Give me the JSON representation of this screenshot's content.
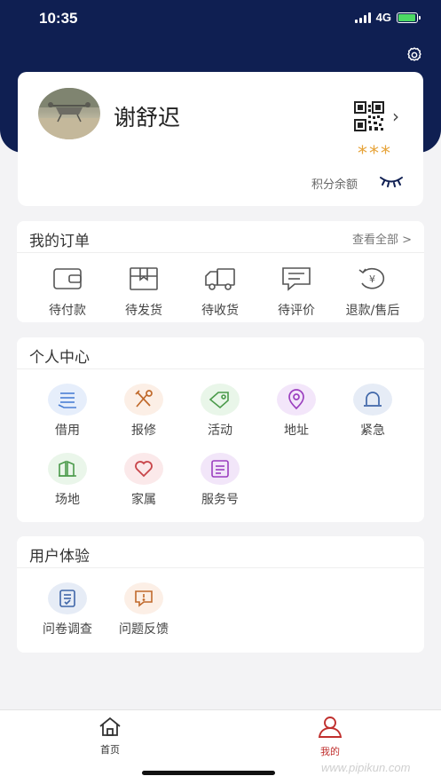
{
  "status_bar": {
    "time": "10:35",
    "network": "4G"
  },
  "profile": {
    "name": "谢舒迟",
    "stars": "***",
    "points_label": "积分余额"
  },
  "orders": {
    "title": "我的订单",
    "view_all": "查看全部 >",
    "items": [
      {
        "label": "待付款",
        "icon": "wallet-icon"
      },
      {
        "label": "待发货",
        "icon": "package-icon"
      },
      {
        "label": "待收货",
        "icon": "truck-icon"
      },
      {
        "label": "待评价",
        "icon": "comment-icon"
      },
      {
        "label": "退款/售后",
        "icon": "refund-icon"
      }
    ]
  },
  "personal_center": {
    "title": "个人中心",
    "items": [
      {
        "label": "借用",
        "icon": "borrow-icon",
        "color": "#4a7fd4"
      },
      {
        "label": "报修",
        "icon": "repair-icon",
        "color": "#c0692b"
      },
      {
        "label": "活动",
        "icon": "tag-icon",
        "color": "#4a9a4a"
      },
      {
        "label": "地址",
        "icon": "location-icon",
        "color": "#9b3fbf"
      },
      {
        "label": "紧急",
        "icon": "alarm-icon",
        "color": "#3f66a8"
      },
      {
        "label": "场地",
        "icon": "venue-icon",
        "color": "#4a9a4a"
      },
      {
        "label": "家属",
        "icon": "heart-icon",
        "color": "#c8454a"
      },
      {
        "label": "服务号",
        "icon": "service-icon",
        "color": "#9b3fbf"
      }
    ]
  },
  "user_experience": {
    "title": "用户体验",
    "items": [
      {
        "label": "问卷调查",
        "icon": "survey-icon",
        "color": "#3f66a8"
      },
      {
        "label": "问题反馈",
        "icon": "feedback-icon",
        "color": "#c0692b"
      }
    ]
  },
  "tabbar": {
    "home": "首页",
    "mine": "我的",
    "active_color": "#c0302e"
  },
  "watermark": "www.pipikun.com"
}
